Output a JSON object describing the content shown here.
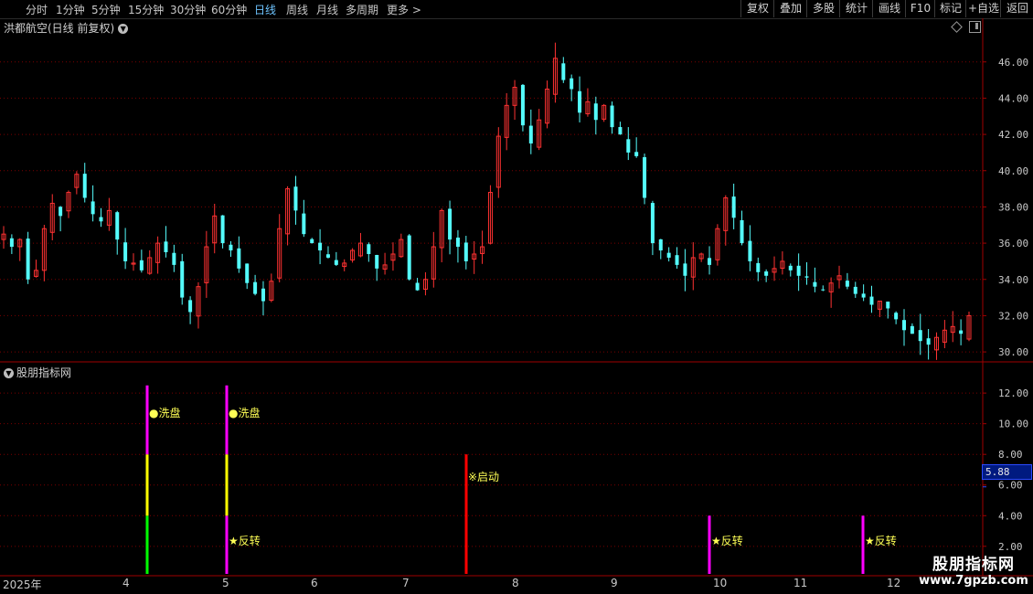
{
  "toolbar": {
    "timeframes": [
      "分时",
      "1分钟",
      "5分钟",
      "15分钟",
      "30分钟",
      "60分钟",
      "日线",
      "周线",
      "月线",
      "多周期",
      "更多 >"
    ],
    "active_timeframe": "日线",
    "right_buttons": [
      "复权",
      "叠加",
      "多股",
      "统计",
      "画线",
      "F10",
      "标记",
      "+自选",
      "返回"
    ]
  },
  "main_chart": {
    "title": "洪都航空(日线 前复权)",
    "y_ticks": [
      "46.00",
      "44.00",
      "42.00",
      "40.00",
      "38.00",
      "36.00",
      "34.00",
      "32.00",
      "30.00"
    ]
  },
  "indicator": {
    "title": "股朋指标网",
    "y_ticks": [
      "12.00",
      "10.00",
      "8.00",
      "6.00",
      "4.00",
      "2.00"
    ],
    "current_value": "5.88",
    "signals": [
      {
        "label": "●洗盘",
        "date_index": 0
      },
      {
        "label": "●洗盘",
        "date_index": 1
      },
      {
        "label": "※启动",
        "date_index": 2
      },
      {
        "label": "★反转",
        "date_index": 1
      },
      {
        "label": "★反转",
        "date_index": 3
      },
      {
        "label": "★反转",
        "date_index": 4
      }
    ]
  },
  "x_axis": {
    "labels": [
      "2025年",
      "4",
      "5",
      "6",
      "7",
      "8",
      "9",
      "10",
      "11",
      "12"
    ]
  },
  "watermark": {
    "line1": "股朋指标网",
    "line2": "www.7gpzb.com"
  },
  "colors": {
    "up": "#ff3232",
    "down": "#54fcfc",
    "grid": "#7a0000",
    "magenta": "#ff00ff",
    "yellow": "#ffff00",
    "green": "#00ff00",
    "red": "#ff0000",
    "active_tab": "#6ec4ff",
    "value_box": "#001a80"
  },
  "chart_data": {
    "type": "candlestick",
    "price_range": [
      29.5,
      47.5
    ],
    "closes": [
      36.5,
      35.8,
      36.2,
      34.0,
      34.5,
      36.8,
      38.2,
      37.5,
      38.8,
      39.8,
      38.5,
      37.6,
      37.2,
      37.8,
      36.2,
      35.0,
      34.9,
      34.5,
      35.2,
      36.0,
      35.5,
      34.8,
      33.0,
      32.2,
      33.6,
      35.8,
      37.5,
      36.0,
      35.6,
      34.6,
      33.8,
      33.2,
      32.8,
      33.9,
      36.8,
      39.0,
      37.8,
      36.5,
      36.0,
      35.6,
      35.2,
      34.8,
      34.9,
      35.6,
      36.0,
      35.4,
      34.6,
      34.8,
      35.4,
      36.2,
      34.0,
      33.4,
      34.0,
      35.8,
      37.8,
      36.2,
      35.8,
      35.0,
      35.4,
      35.8,
      38.8,
      41.9,
      43.6,
      44.6,
      42.5,
      41.5,
      42.8,
      44.5,
      46.2,
      45.0,
      44.5,
      43.2,
      43.8,
      42.8,
      43.6,
      42.4,
      42.0,
      41.0,
      40.8,
      38.5,
      36.0,
      35.6,
      35.2,
      34.8,
      34.2,
      35.2,
      35.4,
      34.8,
      36.8,
      38.5,
      37.4,
      36.0,
      35.0,
      34.4,
      34.2,
      34.6,
      35.0,
      34.5,
      34.2,
      34.1,
      33.6,
      33.4,
      33.8,
      34.2,
      33.6,
      33.2,
      33.0,
      32.6,
      32.8,
      32.4,
      31.8,
      31.2,
      31.0,
      30.6,
      30.4,
      30.8,
      31.2,
      31.4,
      31.0,
      32.0
    ]
  }
}
